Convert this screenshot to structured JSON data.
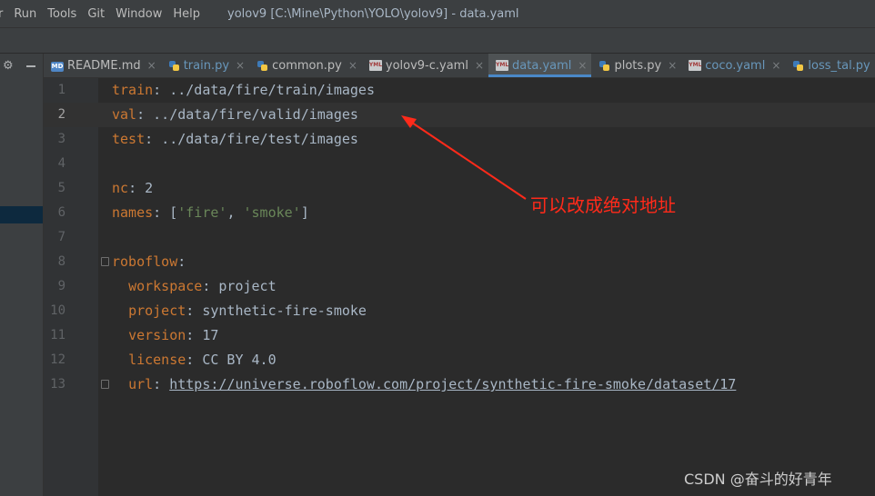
{
  "menu": {
    "items": [
      "r",
      "Run",
      "Tools",
      "Git",
      "Window",
      "Help"
    ],
    "title": "yolov9 [C:\\Mine\\Python\\YOLO\\yolov9] - data.yaml"
  },
  "tabs": [
    {
      "label": "README.md",
      "icon": "md",
      "color": "#bbbbbb"
    },
    {
      "label": "train.py",
      "icon": "py",
      "color": "#6897bb"
    },
    {
      "label": "common.py",
      "icon": "py",
      "color": "#bbbbbb"
    },
    {
      "label": "yolov9-c.yaml",
      "icon": "yml",
      "color": "#bbbbbb"
    },
    {
      "label": "data.yaml",
      "icon": "yml",
      "color": "#6897bb",
      "active": true
    },
    {
      "label": "plots.py",
      "icon": "py",
      "color": "#bbbbbb"
    },
    {
      "label": "coco.yaml",
      "icon": "yml",
      "color": "#6897bb"
    },
    {
      "label": "loss_tal.py",
      "icon": "py",
      "color": "#6897bb"
    }
  ],
  "close_glyph": "×",
  "editor": {
    "line_numbers": [
      "1",
      "2",
      "3",
      "4",
      "5",
      "6",
      "7",
      "8",
      "9",
      "10",
      "11",
      "12",
      "13"
    ],
    "current_line": 2,
    "code": {
      "train_key": "train",
      "train_val": "../data/fire/train/images",
      "val_key": "val",
      "val_val": "../data/fire/valid/images",
      "test_key": "test",
      "test_val": "../data/fire/test/images",
      "nc_key": "nc",
      "nc_val": "2",
      "names_key": "names",
      "names_fire": "'fire'",
      "names_smoke": "'smoke'",
      "roboflow_key": "roboflow",
      "workspace_key": "workspace",
      "workspace_val": "project",
      "project_key": "project",
      "project_val": "synthetic-fire-smoke",
      "version_key": "version",
      "version_val": "17",
      "license_key": "license",
      "license_val": "CC BY 4.0",
      "url_key": "url",
      "url_val": "https://universe.roboflow.com/project/synthetic-fire-smoke/dataset/17"
    }
  },
  "annotation": "可以改成绝对地址",
  "watermark": "CSDN @奋斗的好青年"
}
